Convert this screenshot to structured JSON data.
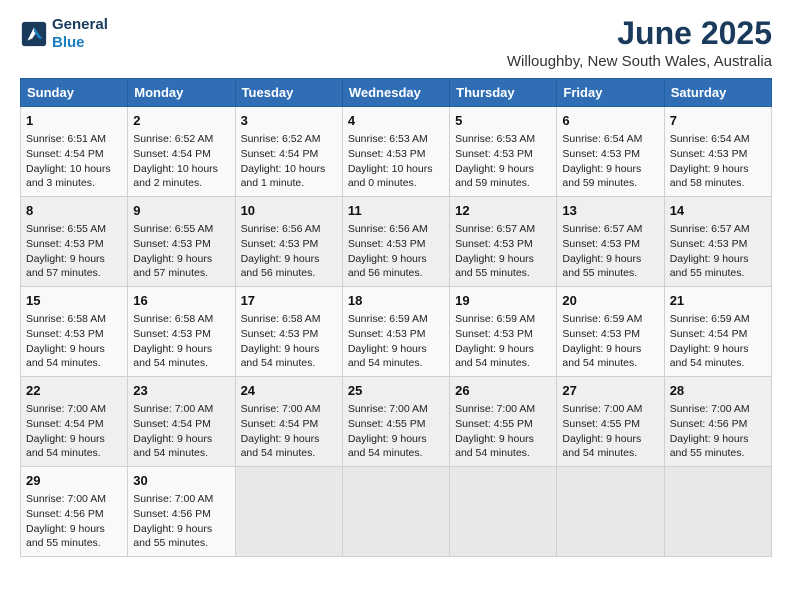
{
  "header": {
    "logo_line1": "General",
    "logo_line2": "Blue",
    "month_title": "June 2025",
    "location": "Willoughby, New South Wales, Australia"
  },
  "days_of_week": [
    "Sunday",
    "Monday",
    "Tuesday",
    "Wednesday",
    "Thursday",
    "Friday",
    "Saturday"
  ],
  "weeks": [
    [
      {
        "day": 1,
        "lines": [
          "Sunrise: 6:51 AM",
          "Sunset: 4:54 PM",
          "Daylight: 10 hours",
          "and 3 minutes."
        ]
      },
      {
        "day": 2,
        "lines": [
          "Sunrise: 6:52 AM",
          "Sunset: 4:54 PM",
          "Daylight: 10 hours",
          "and 2 minutes."
        ]
      },
      {
        "day": 3,
        "lines": [
          "Sunrise: 6:52 AM",
          "Sunset: 4:54 PM",
          "Daylight: 10 hours",
          "and 1 minute."
        ]
      },
      {
        "day": 4,
        "lines": [
          "Sunrise: 6:53 AM",
          "Sunset: 4:53 PM",
          "Daylight: 10 hours",
          "and 0 minutes."
        ]
      },
      {
        "day": 5,
        "lines": [
          "Sunrise: 6:53 AM",
          "Sunset: 4:53 PM",
          "Daylight: 9 hours",
          "and 59 minutes."
        ]
      },
      {
        "day": 6,
        "lines": [
          "Sunrise: 6:54 AM",
          "Sunset: 4:53 PM",
          "Daylight: 9 hours",
          "and 59 minutes."
        ]
      },
      {
        "day": 7,
        "lines": [
          "Sunrise: 6:54 AM",
          "Sunset: 4:53 PM",
          "Daylight: 9 hours",
          "and 58 minutes."
        ]
      }
    ],
    [
      {
        "day": 8,
        "lines": [
          "Sunrise: 6:55 AM",
          "Sunset: 4:53 PM",
          "Daylight: 9 hours",
          "and 57 minutes."
        ]
      },
      {
        "day": 9,
        "lines": [
          "Sunrise: 6:55 AM",
          "Sunset: 4:53 PM",
          "Daylight: 9 hours",
          "and 57 minutes."
        ]
      },
      {
        "day": 10,
        "lines": [
          "Sunrise: 6:56 AM",
          "Sunset: 4:53 PM",
          "Daylight: 9 hours",
          "and 56 minutes."
        ]
      },
      {
        "day": 11,
        "lines": [
          "Sunrise: 6:56 AM",
          "Sunset: 4:53 PM",
          "Daylight: 9 hours",
          "and 56 minutes."
        ]
      },
      {
        "day": 12,
        "lines": [
          "Sunrise: 6:57 AM",
          "Sunset: 4:53 PM",
          "Daylight: 9 hours",
          "and 55 minutes."
        ]
      },
      {
        "day": 13,
        "lines": [
          "Sunrise: 6:57 AM",
          "Sunset: 4:53 PM",
          "Daylight: 9 hours",
          "and 55 minutes."
        ]
      },
      {
        "day": 14,
        "lines": [
          "Sunrise: 6:57 AM",
          "Sunset: 4:53 PM",
          "Daylight: 9 hours",
          "and 55 minutes."
        ]
      }
    ],
    [
      {
        "day": 15,
        "lines": [
          "Sunrise: 6:58 AM",
          "Sunset: 4:53 PM",
          "Daylight: 9 hours",
          "and 54 minutes."
        ]
      },
      {
        "day": 16,
        "lines": [
          "Sunrise: 6:58 AM",
          "Sunset: 4:53 PM",
          "Daylight: 9 hours",
          "and 54 minutes."
        ]
      },
      {
        "day": 17,
        "lines": [
          "Sunrise: 6:58 AM",
          "Sunset: 4:53 PM",
          "Daylight: 9 hours",
          "and 54 minutes."
        ]
      },
      {
        "day": 18,
        "lines": [
          "Sunrise: 6:59 AM",
          "Sunset: 4:53 PM",
          "Daylight: 9 hours",
          "and 54 minutes."
        ]
      },
      {
        "day": 19,
        "lines": [
          "Sunrise: 6:59 AM",
          "Sunset: 4:53 PM",
          "Daylight: 9 hours",
          "and 54 minutes."
        ]
      },
      {
        "day": 20,
        "lines": [
          "Sunrise: 6:59 AM",
          "Sunset: 4:53 PM",
          "Daylight: 9 hours",
          "and 54 minutes."
        ]
      },
      {
        "day": 21,
        "lines": [
          "Sunrise: 6:59 AM",
          "Sunset: 4:54 PM",
          "Daylight: 9 hours",
          "and 54 minutes."
        ]
      }
    ],
    [
      {
        "day": 22,
        "lines": [
          "Sunrise: 7:00 AM",
          "Sunset: 4:54 PM",
          "Daylight: 9 hours",
          "and 54 minutes."
        ]
      },
      {
        "day": 23,
        "lines": [
          "Sunrise: 7:00 AM",
          "Sunset: 4:54 PM",
          "Daylight: 9 hours",
          "and 54 minutes."
        ]
      },
      {
        "day": 24,
        "lines": [
          "Sunrise: 7:00 AM",
          "Sunset: 4:54 PM",
          "Daylight: 9 hours",
          "and 54 minutes."
        ]
      },
      {
        "day": 25,
        "lines": [
          "Sunrise: 7:00 AM",
          "Sunset: 4:55 PM",
          "Daylight: 9 hours",
          "and 54 minutes."
        ]
      },
      {
        "day": 26,
        "lines": [
          "Sunrise: 7:00 AM",
          "Sunset: 4:55 PM",
          "Daylight: 9 hours",
          "and 54 minutes."
        ]
      },
      {
        "day": 27,
        "lines": [
          "Sunrise: 7:00 AM",
          "Sunset: 4:55 PM",
          "Daylight: 9 hours",
          "and 54 minutes."
        ]
      },
      {
        "day": 28,
        "lines": [
          "Sunrise: 7:00 AM",
          "Sunset: 4:56 PM",
          "Daylight: 9 hours",
          "and 55 minutes."
        ]
      }
    ],
    [
      {
        "day": 29,
        "lines": [
          "Sunrise: 7:00 AM",
          "Sunset: 4:56 PM",
          "Daylight: 9 hours",
          "and 55 minutes."
        ]
      },
      {
        "day": 30,
        "lines": [
          "Sunrise: 7:00 AM",
          "Sunset: 4:56 PM",
          "Daylight: 9 hours",
          "and 55 minutes."
        ]
      },
      null,
      null,
      null,
      null,
      null
    ]
  ]
}
